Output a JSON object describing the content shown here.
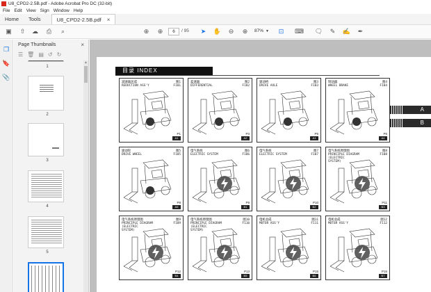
{
  "window": {
    "title": "U8_CPD2-2.5B.pdf - Adobe Acrobat Pro DC (32-bit)"
  },
  "menu": [
    "File",
    "Edit",
    "View",
    "Sign",
    "Window",
    "Help"
  ],
  "tabs": {
    "home": "Home",
    "tools": "Tools",
    "document": "U8_CPD2-2.5B.pdf",
    "close": "×"
  },
  "toolbar": {
    "page_current": "6",
    "page_total": "/ 95",
    "zoom": "87%"
  },
  "panel": {
    "title": "Page Thumbnails",
    "close": "×",
    "thumbs": [
      "1",
      "2",
      "3",
      "4",
      "5"
    ]
  },
  "document": {
    "header": "目录 INDEX",
    "side_tabs": [
      "A",
      "B"
    ],
    "cells": [
      {
        "label": "减速器总成\nREDUCTION ASS'Y",
        "pid": "图1\nF101",
        "page": "P1",
        "tag": "A1"
      },
      {
        "label": "差速器\nDIFFERENTIAL",
        "pid": "图2\nF102",
        "page": "P3",
        "tag": "A2"
      },
      {
        "label": "驱动桥\nDRIVE AXLE",
        "pid": "图3\nF103",
        "page": "P5",
        "tag": "A3"
      },
      {
        "label": "制动器\nWHEEL BRAKE",
        "pid": "图4\nF104",
        "page": "P6",
        "tag": "A4"
      },
      {
        "label": "驱动轮\nDRIVE WHEEL",
        "pid": "图5\nF105",
        "page": "P8",
        "tag": "A5"
      },
      {
        "label": "电气系统\nELECTRIC SYSTEM",
        "pid": "图6\nF106",
        "page": "P9",
        "tag": "B1"
      },
      {
        "label": "电气系统\nELECTRIC SYSTEM",
        "pid": "图7\nF107",
        "page": "P10",
        "tag": "B2"
      },
      {
        "label": "电气系统原理图\nPRINCIPLE DIAGRAM\n(ELECTRIC\nSYSTEM)",
        "pid": "图8\nF108",
        "page": "P11",
        "tag": "B3"
      },
      {
        "label": "电气系统原理图\nPRINCIPLE DIAGRAM\n(ELECTRIC\nSYSTEM)",
        "pid": "图9\nF109",
        "page": "P12",
        "tag": "B4"
      },
      {
        "label": "电气系统原理图\nPRINCIPLE DIAGRAM\n(ELECTRIC\nSYSTEM)",
        "pid": "图10\nF110",
        "page": "P13",
        "tag": "B5"
      },
      {
        "label": "电机总成\nMOTOR ASS'Y",
        "pid": "图11\nF111",
        "page": "P15",
        "tag": "B6"
      },
      {
        "label": "电机总成\nMOTOR ASS'Y",
        "pid": "图12\nF112",
        "page": "P16",
        "tag": "B7"
      }
    ]
  }
}
